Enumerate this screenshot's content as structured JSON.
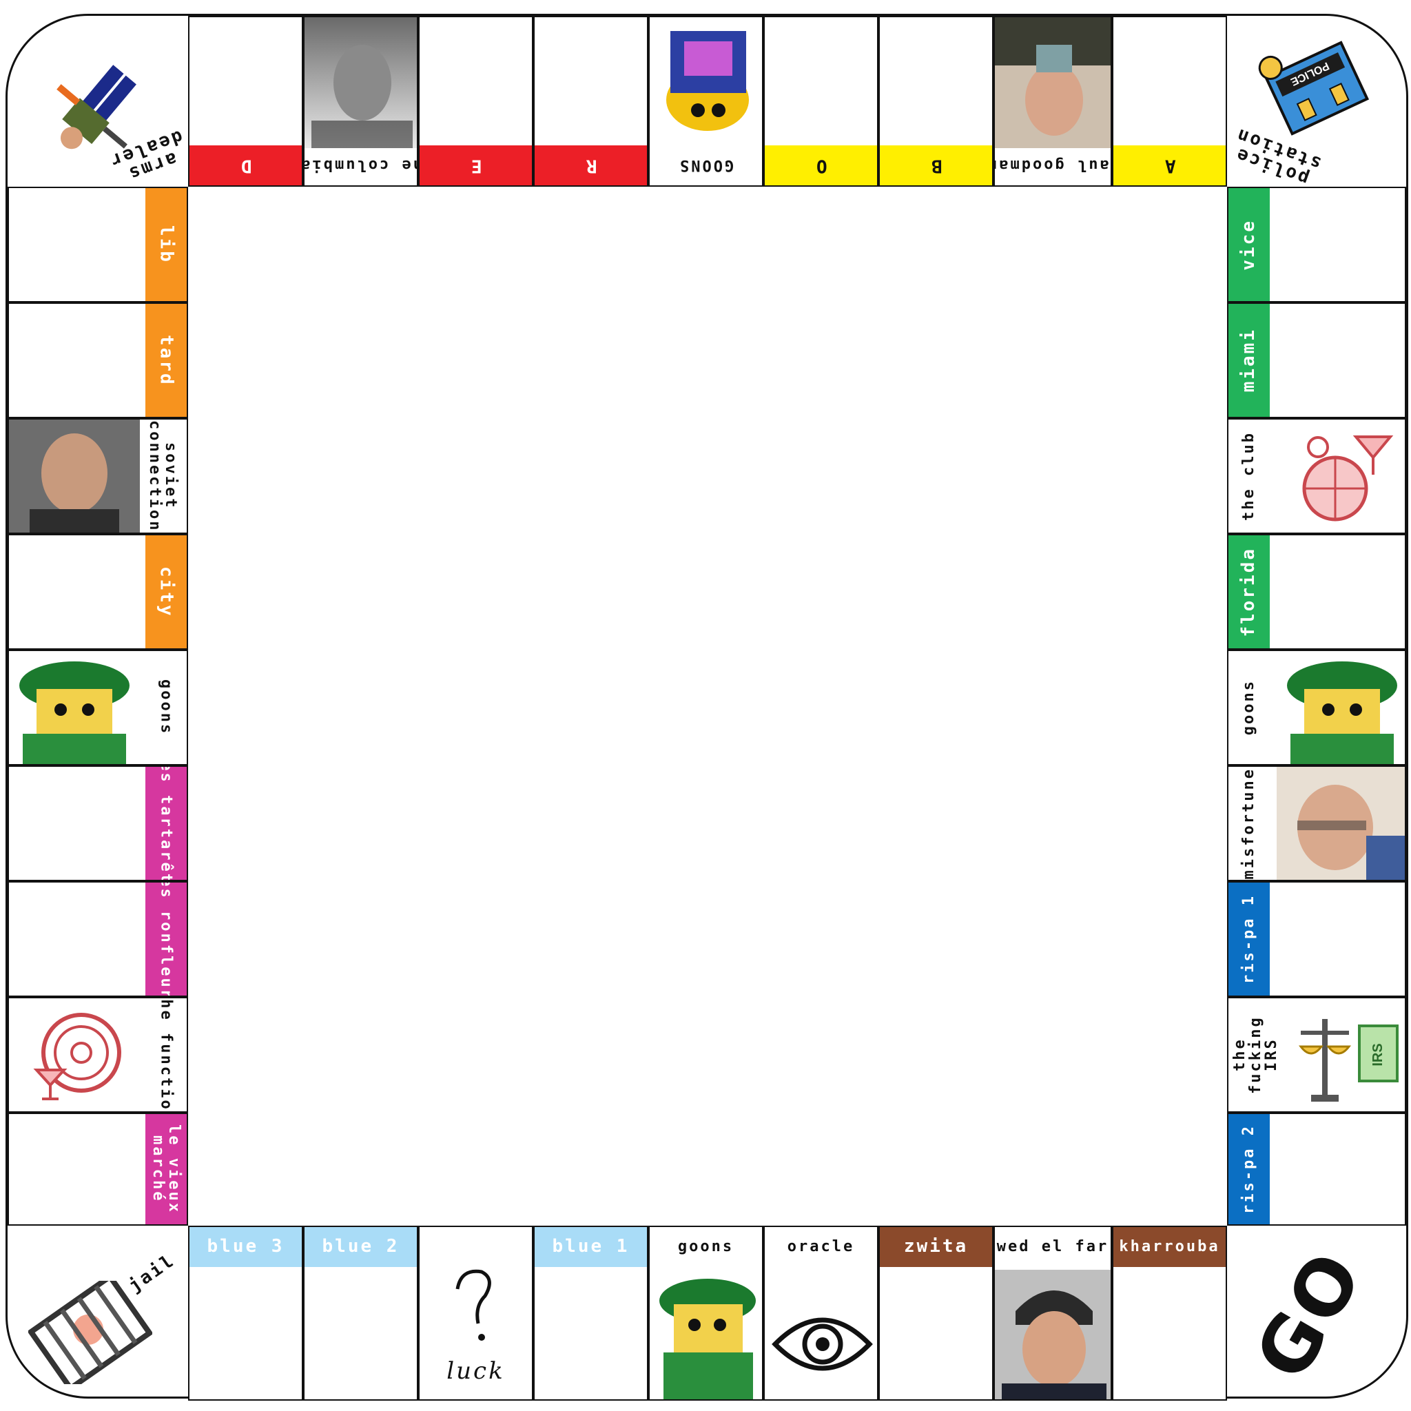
{
  "colors": {
    "red": "#ec1f27",
    "yellow": "#ffef00",
    "orange": "#f7931e",
    "green": "#22b35a",
    "pink": "#d6379f",
    "blue": "#0b6fc3",
    "light_blue": "#a9dcf7",
    "brown": "#8b4a2b"
  },
  "corners": {
    "top_left": "arms dealer",
    "top_right": "police station",
    "top_right_sign": "POLICE",
    "bottom_left": "jail",
    "bottom_right": "GO"
  },
  "top_row": {
    "d": "D",
    "the_columbian": "the columbian",
    "e": "E",
    "r": "R",
    "goons": "GOONS",
    "o": "O",
    "b": "B",
    "saul_goodman": "saul goodman",
    "a": "A"
  },
  "left_column": {
    "lib": "lib",
    "tard": "tard",
    "soviet_connection": "soviet connection",
    "city": "city",
    "goons": "goons",
    "les_tartarets": "les tartarêts",
    "les_ronfleurs": "les ronfleurs",
    "the_function": "the function",
    "le_vieux_marche": "le vieux marché"
  },
  "right_column": {
    "vice": "vice",
    "miami": "miami",
    "the_club": "the club",
    "florida": "florida",
    "goons": "goons",
    "misfortune": "misfortune",
    "ris_pa_1": "ris-pa 1",
    "the_fucking_irs": "the fucking IRS",
    "irs_sign": "IRS",
    "ris_pa_2": "ris-pa 2"
  },
  "bottom_row": {
    "blue_3": "blue 3",
    "blue_2": "blue 2",
    "luck": "luck",
    "blue_1": "blue 1",
    "goons": "goons",
    "oracle": "oracle",
    "zwita": "zwita",
    "wed_el_far": "wed el far",
    "kharrouba": "kharrouba"
  }
}
